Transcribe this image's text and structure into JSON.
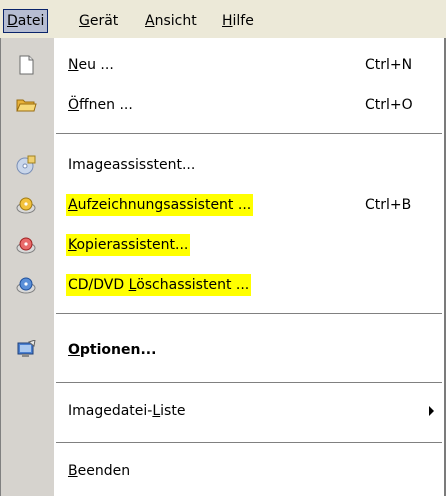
{
  "menubar": {
    "items": [
      {
        "prefix": "",
        "mnemonic": "D",
        "suffix": "atei"
      },
      {
        "prefix": "",
        "mnemonic": "G",
        "suffix": "erät"
      },
      {
        "prefix": "",
        "mnemonic": "A",
        "suffix": "nsicht"
      },
      {
        "prefix": "",
        "mnemonic": "H",
        "suffix": "ilfe"
      }
    ]
  },
  "menu": {
    "items": [
      {
        "prefix": "",
        "mnemonic": "N",
        "suffix": "eu ...",
        "shortcut": "Ctrl+N",
        "icon": "new-file-icon"
      },
      {
        "prefix": "",
        "mnemonic": "Ö",
        "suffix": "ffnen ...",
        "shortcut": "Ctrl+O",
        "icon": "open-folder-icon"
      },
      {
        "text": "Imageassisstent...",
        "icon": "image-wizard-icon"
      },
      {
        "prefix": "",
        "mnemonic": "A",
        "suffix": "ufzeichnungsassistent ...",
        "shortcut": "Ctrl+B",
        "icon": "burn-disc-icon"
      },
      {
        "prefix": "",
        "mnemonic": "K",
        "suffix": "opierassistent...",
        "icon": "copy-disc-icon"
      },
      {
        "prefix": "CD/DVD ",
        "mnemonic": "L",
        "suffix": "öschassistent ...",
        "icon": "erase-disc-icon"
      },
      {
        "prefix": "",
        "mnemonic": "O",
        "suffix": "ptionen...",
        "icon": "options-icon"
      },
      {
        "prefix": "Imagedatei-",
        "mnemonic": "L",
        "suffix": "iste",
        "icon": "submenu-arrow-icon"
      },
      {
        "prefix": "",
        "mnemonic": "B",
        "suffix": "eenden"
      }
    ]
  },
  "colors": {
    "highlight": "#ffff00",
    "menubar_bg": "#ece9d8",
    "active_border": "#0a246a",
    "icon_rail": "#d6d3ce"
  }
}
